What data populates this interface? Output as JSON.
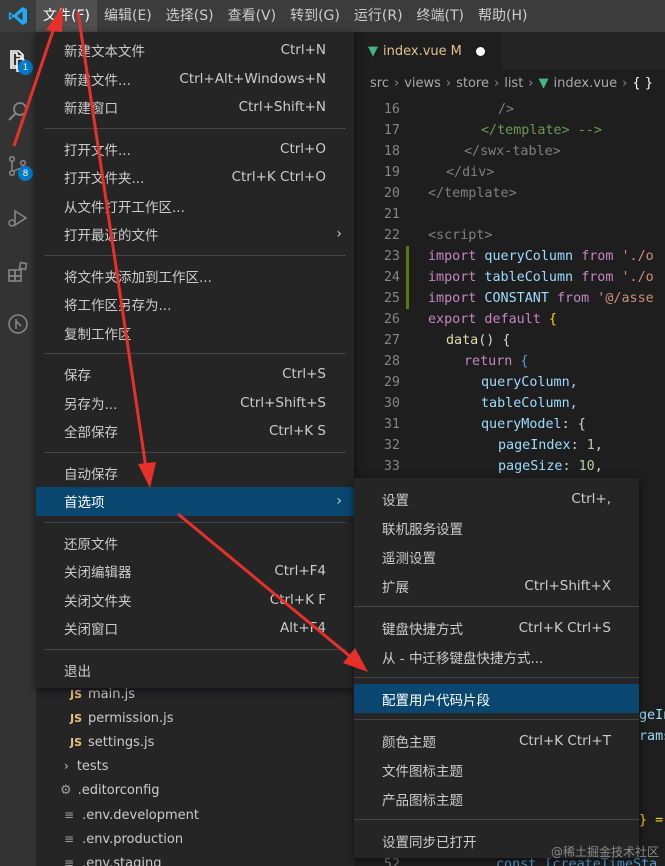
{
  "menubar": {
    "items": [
      "文件(F)",
      "编辑(E)",
      "选择(S)",
      "查看(V)",
      "转到(G)",
      "运行(R)",
      "终端(T)",
      "帮助(H)"
    ],
    "active_index": 0
  },
  "activity": {
    "explorer_badge": "1",
    "scm_badge": "8"
  },
  "explorer": {
    "items": [
      {
        "label": "main.js",
        "kind": "js"
      },
      {
        "label": "permission.js",
        "kind": "js"
      },
      {
        "label": "settings.js",
        "kind": "js"
      },
      {
        "label": "tests",
        "kind": "folder"
      },
      {
        "label": ".editorconfig",
        "kind": "config"
      },
      {
        "label": ".env.development",
        "kind": "env"
      },
      {
        "label": ".env.production",
        "kind": "env"
      },
      {
        "label": ".env.staging",
        "kind": "env"
      }
    ],
    "icon_js": "JS",
    "icon_chevron": "›",
    "icon_gear": "⚙",
    "icon_env": "≡"
  },
  "editor": {
    "tab": {
      "name": "index.vue",
      "modified": "M"
    },
    "vue_icon": "▼",
    "breadcrumb": [
      "src",
      "views",
      "store",
      "list",
      "index.vue",
      "{ }"
    ],
    "breadcrumb_sep": "›",
    "lines": [
      16,
      17,
      18,
      19,
      20,
      21,
      22,
      23,
      24,
      25,
      26,
      27,
      28,
      29,
      30,
      31,
      32,
      33
    ],
    "code": {
      "l16": "/>",
      "l17_a": "</template>",
      "l17_b": " -->",
      "l18": "</swx-table>",
      "l19": "</div>",
      "l20": "</template>",
      "l22": "<script>",
      "l23_kw": "import",
      "l23_var": " queryColumn ",
      "l23_from": "from",
      "l23_str": " './o",
      "l24_kw": "import",
      "l24_var": " tableColumn ",
      "l24_from": "from",
      "l24_str": " './o",
      "l25_kw": "import",
      "l25_var": " CONSTANT ",
      "l25_from": "from",
      "l25_str": " '@/asse",
      "l26_kw": "export",
      "l26_def": " default",
      "l26_brace": " {",
      "l27_fn": "data",
      "l27_rest": "() {",
      "l28_kw": "return",
      "l28_brace": " {",
      "l29": "queryColumn,",
      "l30": "tableColumn,",
      "l31_key": "queryModel",
      "l31_rest": ": {",
      "l32_key": "pageIndex",
      "l32_colon": ": ",
      "l32_num": "1",
      "l32_comma": ",",
      "l33_key": "pageSize",
      "l33_colon": ": ",
      "l33_num": "10",
      "l33_comma": ","
    },
    "partial": {
      "p1": "geIn",
      "p2": "rams",
      "p3": "} =",
      "p4_ln": "52",
      "p4_text": "const [createTimeSta"
    }
  },
  "file_menu": {
    "groups": [
      [
        {
          "label": "新建文本文件",
          "shortcut": "Ctrl+N"
        },
        {
          "label": "新建文件...",
          "shortcut": "Ctrl+Alt+Windows+N"
        },
        {
          "label": "新建窗口",
          "shortcut": "Ctrl+Shift+N"
        }
      ],
      [
        {
          "label": "打开文件...",
          "shortcut": "Ctrl+O"
        },
        {
          "label": "打开文件夹...",
          "shortcut": "Ctrl+K Ctrl+O"
        },
        {
          "label": "从文件打开工作区...",
          "shortcut": ""
        },
        {
          "label": "打开最近的文件",
          "shortcut": "",
          "submenu": true
        }
      ],
      [
        {
          "label": "将文件夹添加到工作区...",
          "shortcut": ""
        },
        {
          "label": "将工作区另存为...",
          "shortcut": ""
        },
        {
          "label": "复制工作区",
          "shortcut": ""
        }
      ],
      [
        {
          "label": "保存",
          "shortcut": "Ctrl+S"
        },
        {
          "label": "另存为...",
          "shortcut": "Ctrl+Shift+S"
        },
        {
          "label": "全部保存",
          "shortcut": "Ctrl+K S"
        }
      ],
      [
        {
          "label": "自动保存",
          "shortcut": ""
        },
        {
          "label": "首选项",
          "shortcut": "",
          "submenu": true,
          "highlighted": true
        }
      ],
      [
        {
          "label": "还原文件",
          "shortcut": ""
        },
        {
          "label": "关闭编辑器",
          "shortcut": "Ctrl+F4"
        },
        {
          "label": "关闭文件夹",
          "shortcut": "Ctrl+K F"
        },
        {
          "label": "关闭窗口",
          "shortcut": "Alt+F4"
        }
      ],
      [
        {
          "label": "退出",
          "shortcut": ""
        }
      ]
    ],
    "submenu_arrow": "›"
  },
  "preferences_menu": {
    "groups": [
      [
        {
          "label": "设置",
          "shortcut": "Ctrl+,"
        },
        {
          "label": "联机服务设置",
          "shortcut": ""
        },
        {
          "label": "遥测设置",
          "shortcut": ""
        },
        {
          "label": "扩展",
          "shortcut": "Ctrl+Shift+X"
        }
      ],
      [
        {
          "label": "键盘快捷方式",
          "shortcut": "Ctrl+K Ctrl+S"
        },
        {
          "label": "从 - 中迁移键盘快捷方式...",
          "shortcut": ""
        }
      ],
      [
        {
          "label": "配置用户代码片段",
          "shortcut": "",
          "highlighted": true
        }
      ],
      [
        {
          "label": "颜色主题",
          "shortcut": "Ctrl+K Ctrl+T"
        },
        {
          "label": "文件图标主题",
          "shortcut": ""
        },
        {
          "label": "产品图标主题",
          "shortcut": ""
        }
      ],
      [
        {
          "label": "设置同步已打开",
          "shortcut": ""
        }
      ]
    ]
  },
  "watermark": "@稀土掘金技术社区",
  "colors": {
    "accent": "#007acc",
    "highlight": "#094771",
    "annotation_arrow": "#e8302a"
  }
}
